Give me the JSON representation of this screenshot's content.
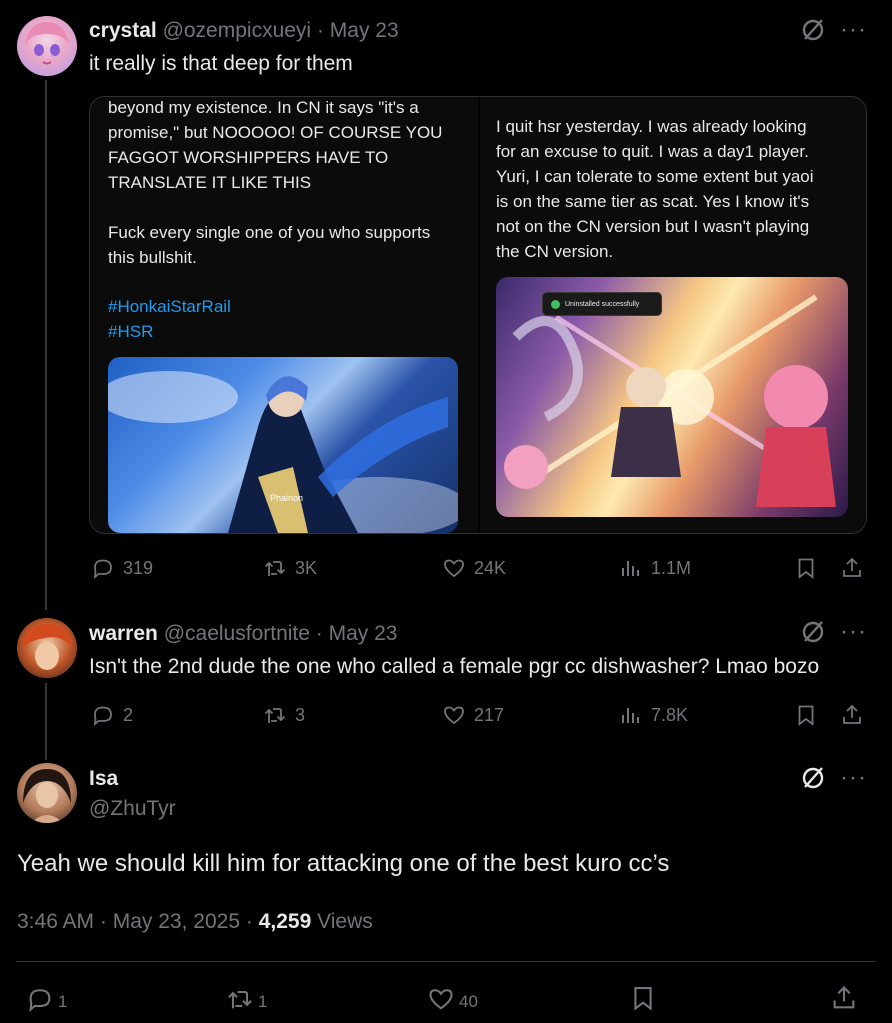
{
  "tweets": [
    {
      "name": "crystal",
      "handle": "@ozempicxueyi",
      "date": "· May 23",
      "text": "it really is that deep for them",
      "stats": {
        "replies": "319",
        "reposts": "3K",
        "likes": "24K",
        "views": "1.1M"
      },
      "media": {
        "left_text": "beyond my existence. In CN it says \"it's a\npromise,\" but NOOOOO! OF COURSE YOU\nFAGGOT WORSHIPPERS HAVE TO\nTRANSLATE IT LIKE THIS\n\nFuck every single one of you who supports\nthis bullshit.",
        "left_tags": [
          "#HonkaiStarRail",
          "#HSR"
        ],
        "left_image_caption": "Phainon",
        "right_text": "I quit hsr yesterday. I was already looking\nfor an excuse to quit. I was a day1 player.\nYuri, I can tolerate to some extent but yaoi\nis on the same tier as scat. Yes I know it's\nnot on the CN version but I wasn't playing\nthe CN version.",
        "toast": "Uninstalled successfully"
      }
    },
    {
      "name": "warren",
      "handle": "@caelusfortnite",
      "date": "· May 23",
      "text": "Isn't the 2nd dude the one who called a female pgr cc dishwasher? Lmao bozo",
      "stats": {
        "replies": "2",
        "reposts": "3",
        "likes": "217",
        "views": "7.8K"
      }
    }
  ],
  "main_tweet": {
    "name": "Isa",
    "handle": "@ZhuTyr",
    "text": "Yeah we should kill him for attacking one of the best kuro cc’s",
    "time": "3:46 AM",
    "date": "May 23, 2025",
    "views_count": "4,259",
    "views_label": "Views",
    "stats": {
      "replies": "1",
      "reposts": "1",
      "likes": "40"
    }
  },
  "colors": {
    "background": "#000000",
    "text": "#e7e9ea",
    "muted": "#71767b",
    "link": "#1d9bf0",
    "border": "#2f3336"
  },
  "icons": [
    "grok-icon",
    "more-icon",
    "reply-icon",
    "repost-icon",
    "like-icon",
    "views-icon",
    "bookmark-icon",
    "share-icon"
  ]
}
